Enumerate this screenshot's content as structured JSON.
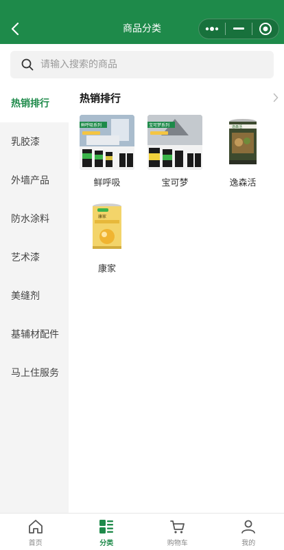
{
  "navbar": {
    "title": "商品分类"
  },
  "search": {
    "placeholder": "请输入搜索的商品"
  },
  "sidebar": {
    "items": [
      {
        "label": "热销排行",
        "active": true
      },
      {
        "label": "乳胶漆"
      },
      {
        "label": "外墙产品"
      },
      {
        "label": "防水涂料"
      },
      {
        "label": "艺术漆"
      },
      {
        "label": "美缝剂"
      },
      {
        "label": "基辅材配件"
      },
      {
        "label": "马上住服务"
      }
    ]
  },
  "section": {
    "title": "热销排行"
  },
  "products": [
    {
      "name": "鲜呼吸",
      "image_text": "鲜呼吸系列"
    },
    {
      "name": "宝可梦",
      "image_text": "宝可梦系列"
    },
    {
      "name": "逸森活",
      "image_text": "逸森活"
    },
    {
      "name": "康家",
      "image_text": "康家"
    }
  ],
  "tabbar": {
    "items": [
      {
        "label": "首页",
        "icon": "home-icon"
      },
      {
        "label": "分类",
        "icon": "category-icon",
        "active": true
      },
      {
        "label": "购物车",
        "icon": "cart-icon"
      },
      {
        "label": "我的",
        "icon": "user-icon"
      }
    ]
  },
  "colors": {
    "brand": "#1e8a4a",
    "sidebar_bg": "#f4f4f4"
  }
}
